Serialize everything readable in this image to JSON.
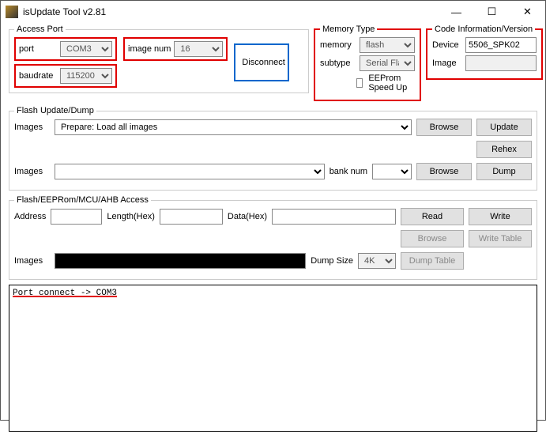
{
  "window": {
    "title": "isUpdate Tool v2.81"
  },
  "access_port": {
    "legend": "Access Port",
    "port_label": "port",
    "port_value": "COM3",
    "baud_label": "baudrate",
    "baud_value": "115200",
    "imgnum_label": "image num",
    "imgnum_value": "16",
    "disconnect": "Disconnect"
  },
  "memory_type": {
    "legend": "Memory Type",
    "memory_label": "memory",
    "memory_value": "flash",
    "subtype_label": "subtype",
    "subtype_value": "Serial Flash",
    "eeprom_label": "EEProm Speed Up"
  },
  "code_info": {
    "legend": "Code Information/Version",
    "device_label": "Device",
    "device_value": "5506_SPK02",
    "image_label": "Image",
    "image_value": ""
  },
  "flash_update": {
    "legend": "Flash Update/Dump",
    "images_label": "Images",
    "images_value": "Prepare: Load all images",
    "browse": "Browse",
    "update": "Update",
    "rehex": "Rehex",
    "banknum_label": "bank num",
    "dump": "Dump"
  },
  "access": {
    "legend": "Flash/EEPRom/MCU/AHB Access",
    "address_label": "Address",
    "length_label": "Length(Hex)",
    "data_label": "Data(Hex)",
    "read": "Read",
    "write": "Write",
    "browse": "Browse",
    "write_table": "Write Table",
    "images_label": "Images",
    "dump_size_label": "Dump Size",
    "dump_size_value": "4K",
    "dump_table": "Dump Table"
  },
  "console": {
    "line1": "Port connect -> COM3"
  }
}
